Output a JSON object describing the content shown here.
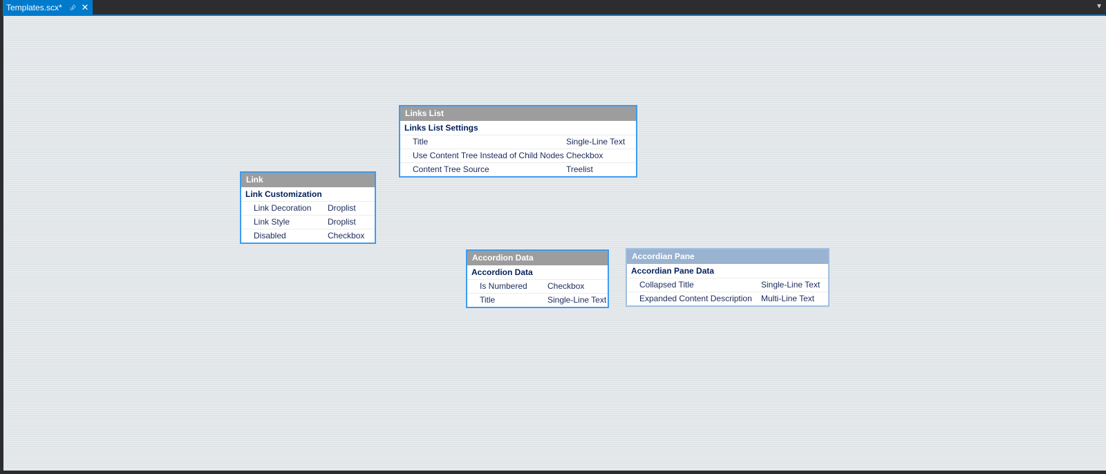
{
  "tab": {
    "title": "Templates.scx*",
    "pin_icon": "pin-icon",
    "close_icon": "close-icon"
  },
  "colors": {
    "accent": "#007acc",
    "box_border": "#3c9bf0",
    "header_gray": "#9d9d9d",
    "header_faded": "#99b3d1",
    "section_text": "#001f5c"
  },
  "templates": [
    {
      "header": "Links List",
      "section": "Links List Settings",
      "fields": [
        {
          "name": "Title",
          "type": "Single-Line Text"
        },
        {
          "name": "Use Content Tree Instead of Child Nodes",
          "type": "Checkbox"
        },
        {
          "name": "Content Tree Source",
          "type": "Treelist"
        }
      ]
    },
    {
      "header": "Link",
      "section": "Link Customization",
      "fields": [
        {
          "name": "Link Decoration",
          "type": "Droplist"
        },
        {
          "name": "Link Style",
          "type": "Droplist"
        },
        {
          "name": "Disabled",
          "type": "Checkbox"
        }
      ]
    },
    {
      "header": "Accordion Data",
      "section": "Accordion Data",
      "fields": [
        {
          "name": "Is Numbered",
          "type": "Checkbox"
        },
        {
          "name": "Title",
          "type": "Single-Line Text"
        }
      ]
    },
    {
      "header": "Accordian Pane",
      "section": "Accordian Pane Data",
      "fields": [
        {
          "name": "Collapsed Title",
          "type": "Single-Line Text"
        },
        {
          "name": "Expanded Content Description",
          "type": "Multi-Line Text"
        }
      ]
    }
  ]
}
